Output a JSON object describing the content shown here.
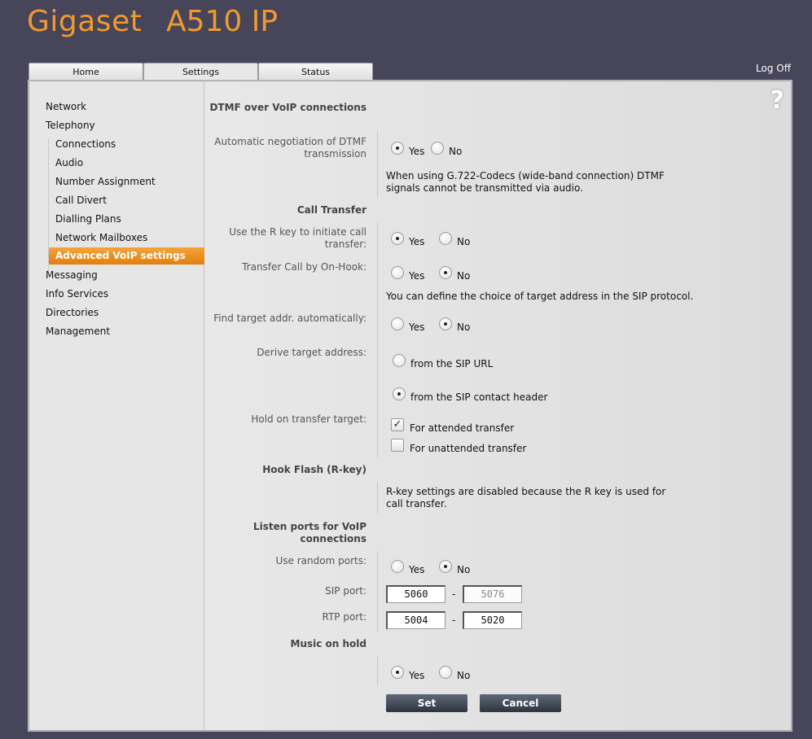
{
  "header": {
    "brand": "Gigaset",
    "model": "A510 IP",
    "logoff": "Log Off"
  },
  "tabs": [
    {
      "label": "Home"
    },
    {
      "label": "Settings"
    },
    {
      "label": "Status"
    }
  ],
  "sidebar": {
    "items": [
      "Network",
      "Telephony",
      "Messaging",
      "Info Services",
      "Directories",
      "Management"
    ],
    "telephony_sub": [
      "Connections",
      "Audio",
      "Number Assignment",
      "Call Divert",
      "Dialling Plans",
      "Network Mailboxes",
      "Advanced VoIP settings"
    ]
  },
  "content": {
    "help_icon": "?",
    "dtmf": {
      "section": "DTMF over VoIP connections",
      "auto_neg_label": "Automatic negotiation of DTMF transmission",
      "yes": "Yes",
      "no": "No",
      "note": "When using G.722-Codecs (wide-band connection) DTMF signals cannot be transmitted via audio."
    },
    "transfer": {
      "section": "Call Transfer",
      "rkey_label": "Use the R key to initiate call transfer:",
      "onhook_label": "Transfer Call by On-Hook:",
      "note": "You can define the choice of target address in the SIP protocol.",
      "find_label": "Find target addr. automatically:",
      "derive_label": "Derive target address:",
      "derive_opt1": "from the SIP URL",
      "derive_opt2": "from the SIP contact header",
      "hold_label": "Hold on transfer target:",
      "hold_opt1": "For attended transfer",
      "hold_opt2": "For unattended transfer",
      "yes": "Yes",
      "no": "No"
    },
    "hookflash": {
      "section": "Hook Flash (R-key)",
      "note": "R-key settings are disabled because the R key is used for call transfer."
    },
    "ports": {
      "section": "Listen ports for VoIP connections",
      "random_label": "Use random ports:",
      "sip_label": "SIP port:",
      "rtp_label": "RTP port:",
      "sip_from": "5060",
      "sip_to": "5076",
      "rtp_from": "5004",
      "rtp_to": "5020",
      "dash": "-",
      "yes": "Yes",
      "no": "No"
    },
    "moh": {
      "section": "Music on hold",
      "yes": "Yes",
      "no": "No"
    },
    "buttons": {
      "set": "Set",
      "cancel": "Cancel"
    }
  }
}
